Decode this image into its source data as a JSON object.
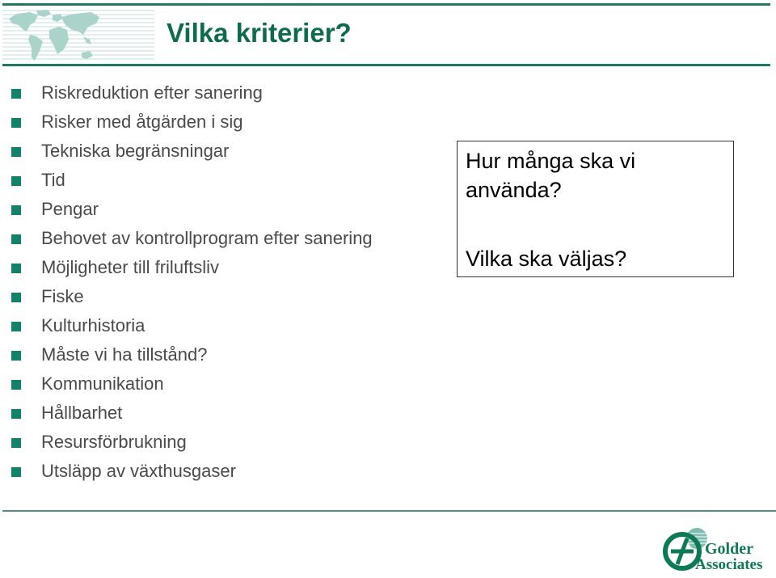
{
  "header": {
    "title": "Vilka kriterier?",
    "banner_icon": "world-map-icon"
  },
  "colors": {
    "accent_green": "#0e6b4e",
    "bullet_green": "#13826a",
    "rule_green": "#1f7a65",
    "map_tint": "#a9d3cb",
    "body_text": "#4a4a4a"
  },
  "criteria": [
    "Riskreduktion efter sanering",
    "Risker med åtgärden i sig",
    "Tekniska begränsningar",
    "Tid",
    "Pengar",
    "Behovet av kontrollprogram efter sanering",
    "Möjligheter till friluftsliv",
    "Fiske",
    "Kulturhistoria",
    "Måste vi ha tillstånd?",
    "Kommunikation",
    "Hållbarhet",
    "Resursförbrukning",
    "Utsläpp av växthusgaser"
  ],
  "question_box": {
    "line1": "Hur många ska vi",
    "line2": "använda?",
    "line3": "Vilka ska väljas?"
  },
  "footer": {
    "logo_line1": "Golder",
    "logo_line2": "Associates",
    "logo_icon": "golder-globe-logo-icon"
  }
}
